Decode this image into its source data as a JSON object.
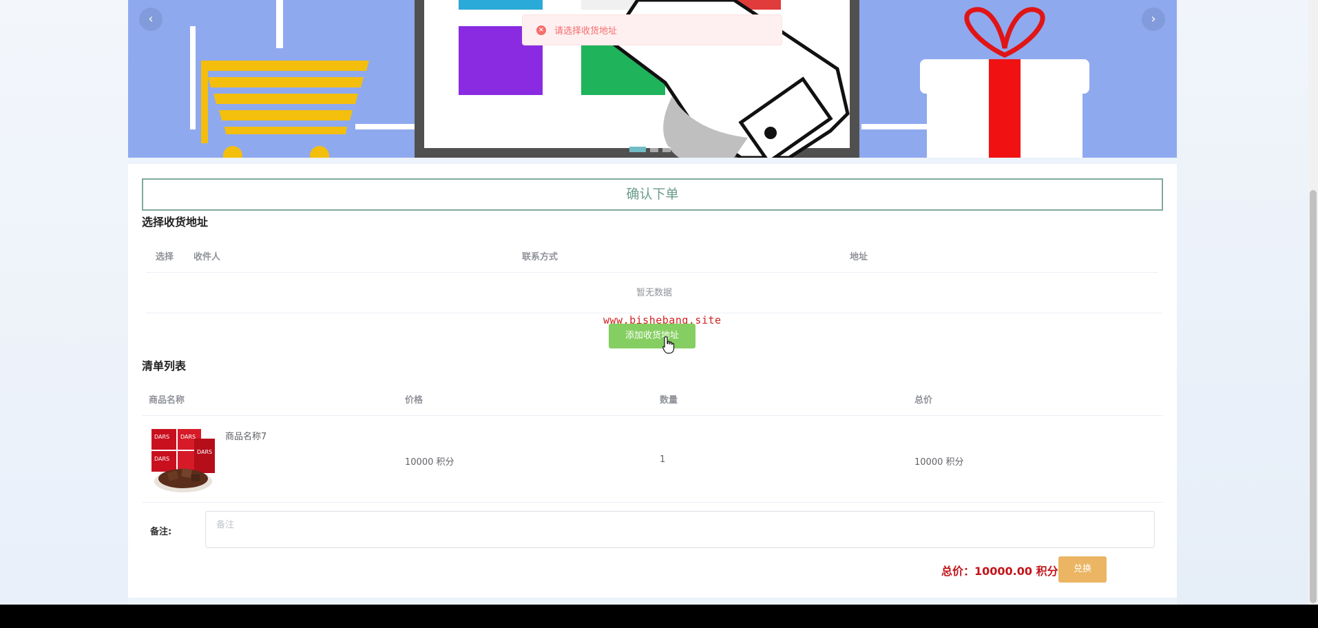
{
  "toast": {
    "message": "请选择收货地址",
    "icon": "error-circle-icon"
  },
  "banner": {
    "prev_label": "‹",
    "next_label": "›",
    "indicator_count": 3,
    "active_indicator": 1
  },
  "page": {
    "confirm_title": "确认下单"
  },
  "address": {
    "title": "选择收货地址",
    "columns": [
      "选择",
      "收件人",
      "联系方式",
      "地址"
    ],
    "empty_text": "暂无数据",
    "add_button": "添加收货地址"
  },
  "watermark": "www.bishebang.site",
  "list": {
    "title": "清单列表",
    "columns": [
      "商品名称",
      "价格",
      "数量",
      "总价"
    ],
    "rows": [
      {
        "name": "商品名称7",
        "price": "10000 积分",
        "qty": "1",
        "total": "10000 积分"
      }
    ]
  },
  "remark": {
    "label": "备注:",
    "placeholder": "备注"
  },
  "summary": {
    "total_text": "总价：10000.00 积分",
    "redeem_button": "兑换"
  },
  "colors": {
    "accent_green": "#85ce61",
    "accent_orange": "#ebb563",
    "error_red": "#f56c6c",
    "total_red": "#c2141a"
  }
}
